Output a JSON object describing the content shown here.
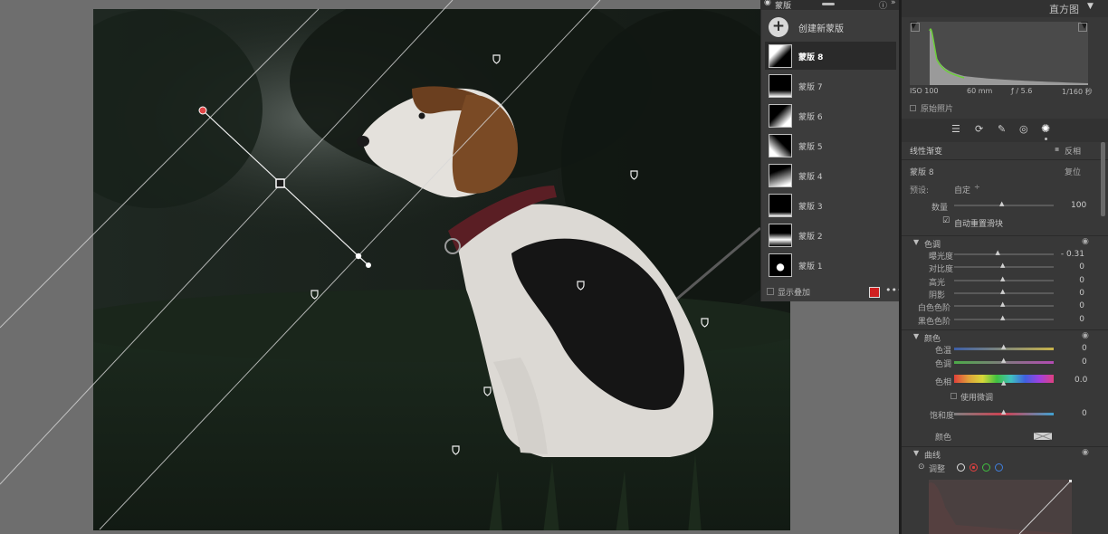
{
  "masks_panel": {
    "title": "蒙版",
    "create_label": "创建新蒙版",
    "items": [
      "蒙版 8",
      "蒙版 7",
      "蒙版 6",
      "蒙版 5",
      "蒙版 4",
      "蒙版 3",
      "蒙版 2",
      "蒙版 1"
    ],
    "selected_index": 0,
    "show_overlay_label": "显示叠加",
    "overlay_color": "#d02020"
  },
  "histogram": {
    "title": "直方图",
    "iso": "ISO 100",
    "focal": "60 mm",
    "aperture": "ƒ / 5.6",
    "shutter": "1/160 秒",
    "original_label": "原始照片"
  },
  "mask_settings": {
    "type_label": "线性渐变",
    "invert_label": "反相",
    "mask_name": "蒙版 8",
    "reset_label": "复位",
    "preset_label": "预设:",
    "preset_value": "自定",
    "amount_label": "数量",
    "amount_value": "100",
    "auto_reset_label": "自动重置滑块"
  },
  "tone": {
    "title": "色调",
    "rows": [
      {
        "label": "曝光度",
        "value": "- 0.31",
        "pos": 0.45
      },
      {
        "label": "对比度",
        "value": "0",
        "pos": 0.5
      },
      {
        "label": "高光",
        "value": "0",
        "pos": 0.5
      },
      {
        "label": "阴影",
        "value": "0",
        "pos": 0.5
      },
      {
        "label": "白色色阶",
        "value": "0",
        "pos": 0.5
      },
      {
        "label": "黑色色阶",
        "value": "0",
        "pos": 0.5
      }
    ]
  },
  "color": {
    "title": "颜色",
    "temp_label": "色温",
    "temp_value": "0",
    "tint_label": "色调",
    "tint_value": "0",
    "hue_label": "色相",
    "hue_value": "0.0",
    "fine_label": "使用微调",
    "sat_label": "饱和度",
    "sat_value": "0",
    "color_label": "颜色"
  },
  "curve": {
    "title": "曲线",
    "adjust_label": "调整"
  },
  "colors": {
    "panel_bg": "#3c3c3c",
    "header_bg": "#323232",
    "selected_bg": "#2a2a2a",
    "accent_green": "#6ccf3a",
    "pin_red": "#e04545"
  }
}
